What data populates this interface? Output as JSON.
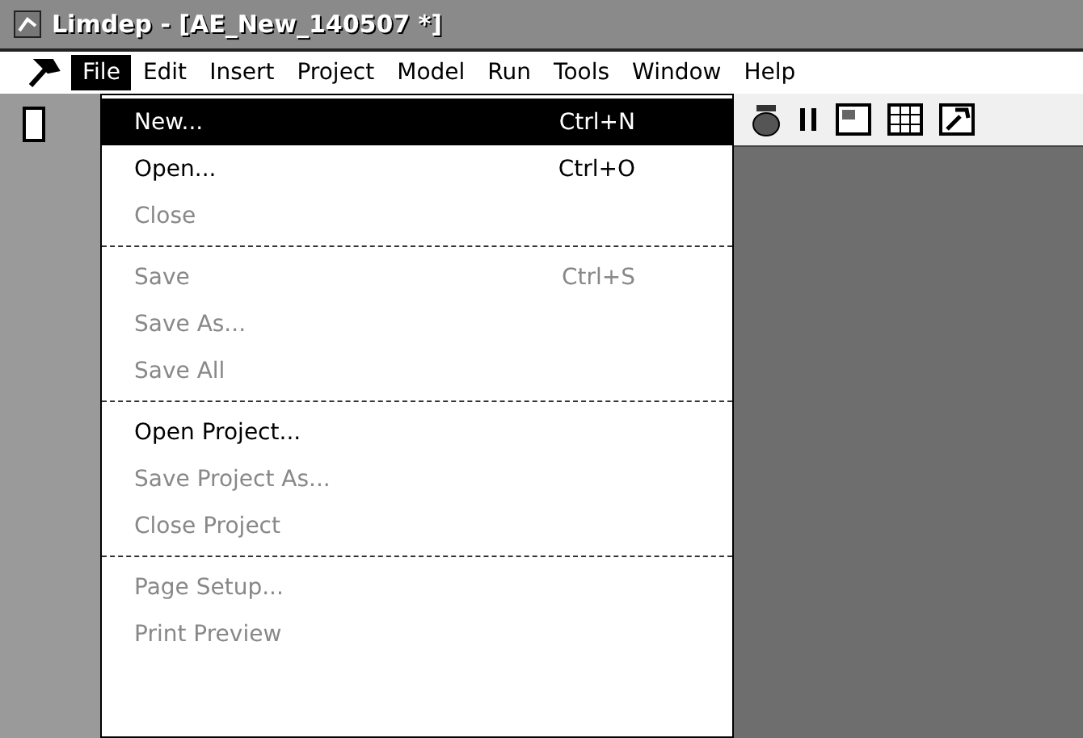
{
  "window": {
    "title": "Limdep - [AE_New_140507 *]"
  },
  "menubar": [
    {
      "label": "File",
      "selected": true
    },
    {
      "label": "Edit",
      "selected": false
    },
    {
      "label": "Insert",
      "selected": false
    },
    {
      "label": "Project",
      "selected": false
    },
    {
      "label": "Model",
      "selected": false
    },
    {
      "label": "Run",
      "selected": false
    },
    {
      "label": "Tools",
      "selected": false
    },
    {
      "label": "Window",
      "selected": false
    },
    {
      "label": "Help",
      "selected": false
    }
  ],
  "file_menu": [
    {
      "kind": "item",
      "label": "New...",
      "shortcut": "Ctrl+N",
      "selected": true,
      "disabled": false
    },
    {
      "kind": "item",
      "label": "Open...",
      "shortcut": "Ctrl+O",
      "selected": false,
      "disabled": false
    },
    {
      "kind": "item",
      "label": "Close",
      "selected": false,
      "disabled": true
    },
    {
      "kind": "separator"
    },
    {
      "kind": "item",
      "label": "Save",
      "shortcut": "Ctrl+S",
      "selected": false,
      "disabled": true
    },
    {
      "kind": "item",
      "label": "Save As...",
      "selected": false,
      "disabled": true
    },
    {
      "kind": "item",
      "label": "Save All",
      "selected": false,
      "disabled": true
    },
    {
      "kind": "separator"
    },
    {
      "kind": "item",
      "label": "Open Project...",
      "selected": false,
      "disabled": false
    },
    {
      "kind": "item",
      "label": "Save Project As...",
      "selected": false,
      "disabled": true
    },
    {
      "kind": "item",
      "label": "Close Project",
      "selected": false,
      "disabled": true
    },
    {
      "kind": "separator"
    },
    {
      "kind": "item",
      "label": "Page Setup...",
      "selected": false,
      "disabled": true
    },
    {
      "kind": "item",
      "label": "Print Preview",
      "selected": false,
      "disabled": true
    }
  ]
}
